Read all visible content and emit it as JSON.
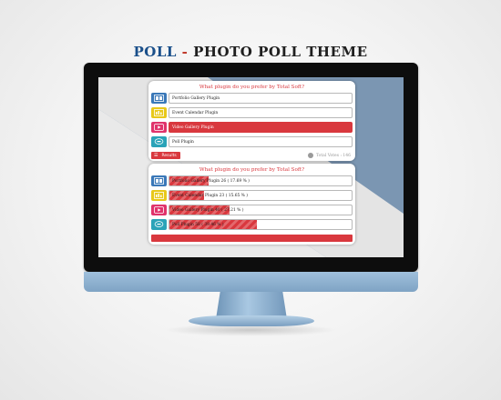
{
  "header": {
    "brand": "POLL",
    "separator": " - ",
    "title": "PHOTO POLL THEME"
  },
  "colors": {
    "accent": "#d9383e",
    "portfolio_icon": "#3a78b8",
    "calendar_icon": "#e8c81a",
    "video_icon": "#e0336b",
    "poll_icon": "#2aa3b8",
    "screen_bg": "#7b96b2"
  },
  "vote_panel": {
    "question": "What plugin do you prefer by Total Soft?",
    "options": [
      {
        "label": "Portfolio Gallery Plugin",
        "icon": "gallery-icon",
        "selected": false
      },
      {
        "label": "Event Calendar Plugin",
        "icon": "calendar-icon",
        "selected": false
      },
      {
        "label": "Video Gallery Plugin",
        "icon": "video-icon",
        "selected": true
      },
      {
        "label": "Poll Plugin",
        "icon": "poll-icon",
        "selected": false
      }
    ],
    "results_label": "Results",
    "total_votes": "Total Votes : 146"
  },
  "results_panel": {
    "question": "What plugin do you prefer by Total Soft?",
    "results": [
      {
        "text": "Portfolio Gallery Plugin 26 ( 17.69 % )",
        "percent": 17.69,
        "icon": "gallery-icon"
      },
      {
        "text": "Event Calendar Plugin 23 ( 15.65 % )",
        "percent": 15.65,
        "icon": "calendar-icon"
      },
      {
        "text": "Video Gallery Plugin 40 ( 27.21 % )",
        "percent": 27.21,
        "icon": "video-icon"
      },
      {
        "text": "Poll Plugin 58 ( 39.46 % )",
        "percent": 39.46,
        "icon": "poll-icon"
      }
    ]
  }
}
